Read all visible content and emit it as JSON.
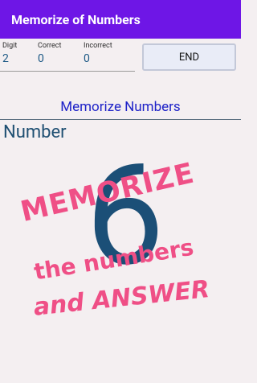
{
  "appbar": {
    "title": "Memorize of Numbers"
  },
  "stats": [
    {
      "label": "Digit",
      "value": "2"
    },
    {
      "label": "Correct",
      "value": "0"
    },
    {
      "label": "Incorrect",
      "value": "0"
    }
  ],
  "end_button": {
    "label": "END"
  },
  "section": {
    "title": "Memorize Numbers"
  },
  "number": {
    "label": "Number",
    "digit": "6"
  },
  "overlay": {
    "line1": "MEMORIZE",
    "line2": "the numbers",
    "line3": "and  ANSWER"
  },
  "colors": {
    "appbar": "#6e16e6",
    "accent_blue": "#1f23c8",
    "digit": "#1b4f77",
    "overlay_pink": "#ef4f86"
  }
}
